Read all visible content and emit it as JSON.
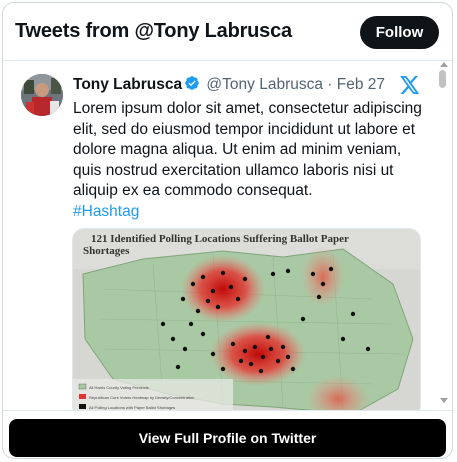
{
  "header": {
    "title": "Tweets from @Tony Labrusca",
    "follow_label": "Follow"
  },
  "tweet": {
    "author_name": "Tony Labrusca",
    "handle": "@Tony Labrusca",
    "separator": "·",
    "date": "Feb 27",
    "text": "Lorem ipsum dolor sit amet, consectetur adipiscing elit, sed do eiusmod tempor incididunt ut labore et dolore magna aliqua. Ut enim ad minim veniam, quis nostrud exercitation ullamco laboris nisi ut aliquip ex ea commodo consequat.",
    "hashtag": "#Hashtag",
    "verified_icon": "verified-badge-icon",
    "platform_icon": "x-logo-icon",
    "media": {
      "title_line1": "121 Identified Polling Locations Suffering Ballot Paper",
      "title_line2": "Shortages",
      "legend": [
        "All Harris County Voting Precincts",
        "Republican Core Voters Heatmap by Density/Concentration",
        "All Polling Locations with Paper Ballot Shortages"
      ]
    }
  },
  "footer": {
    "profile_button_label": "View Full Profile on Twitter"
  },
  "colors": {
    "accent_link": "#1d9bf0",
    "verified": "#1d9bf0",
    "button_dark": "#0f1419",
    "secondary_text": "#536471"
  }
}
